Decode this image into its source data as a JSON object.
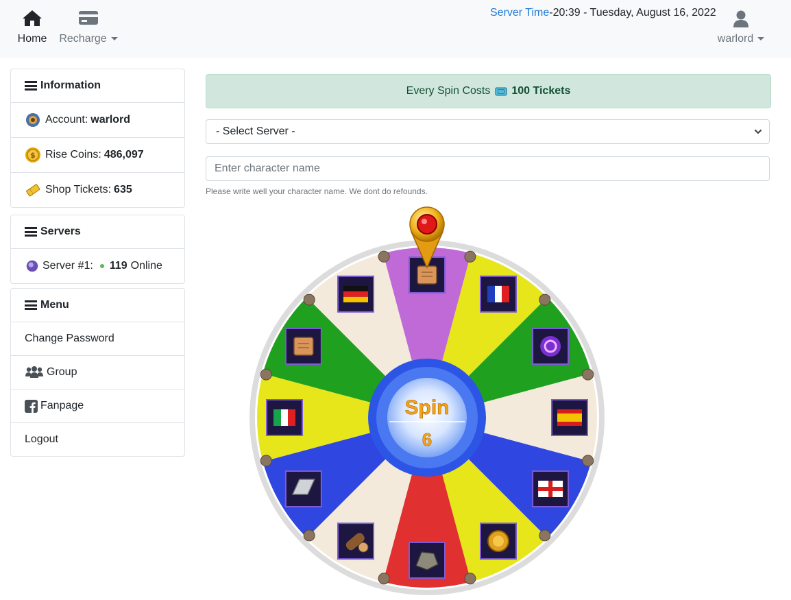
{
  "nav": {
    "home_label": "Home",
    "recharge_label": "Recharge",
    "user_label": "warlord"
  },
  "server_time": {
    "label": "Server Time",
    "value": "-20:39 - Tuesday, August 16, 2022"
  },
  "sidebar": {
    "information": {
      "title": "Information",
      "account_label": "Account:",
      "account_value": "warlord",
      "coins_label": "Rise Coins:",
      "coins_value": "486,097",
      "tickets_label": "Shop Tickets:",
      "tickets_value": "635"
    },
    "servers": {
      "title": "Servers",
      "server_label": "Server #1:",
      "online_count": "119",
      "online_label": "Online",
      "status_color": "#5cb85c"
    },
    "menu": {
      "title": "Menu",
      "items": [
        "Change Password",
        "Group",
        "Fanpage",
        "Logout"
      ]
    }
  },
  "main": {
    "cost_text": "Every Spin Costs",
    "cost_value": "100 Tickets",
    "server_select": "- Select Server -",
    "character_placeholder": "Enter character name",
    "help_text": "Please write well your character name. We dont do refounds.",
    "spin_label": "Spin",
    "spin_count": "6"
  },
  "wheel": {
    "segment_colors": [
      "#c06ad8",
      "#e6e61a",
      "#1fa01f",
      "#f3eadb",
      "#2f46e0",
      "#e6e61a",
      "#e03030",
      "#f3eadb",
      "#2f46e0",
      "#e6e61a",
      "#1fa01f",
      "#f3eadb"
    ],
    "prizes": [
      "scroll-icon",
      "france-flag-icon",
      "purple-orb-icon",
      "spain-flag-icon",
      "england-flag-icon",
      "gold-coin-icon",
      "ore-icon",
      "wood-log-icon",
      "silver-bar-icon",
      "italy-flag-icon",
      "scroll-icon",
      "germany-flag-icon"
    ]
  }
}
